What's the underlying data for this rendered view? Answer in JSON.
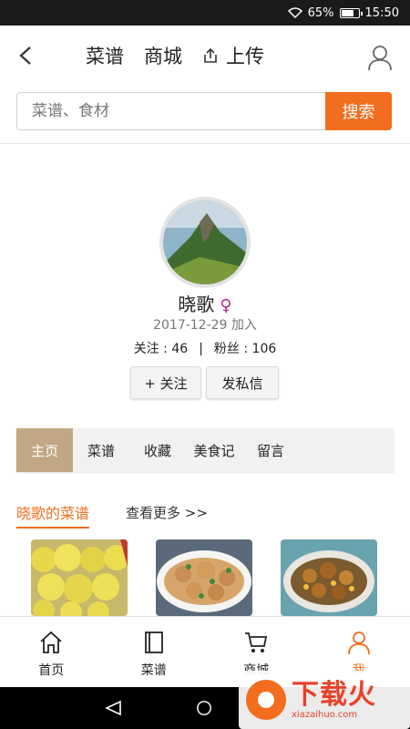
{
  "status_bar": {
    "battery": "65%",
    "time": "15:50",
    "battery_level": 0.65
  },
  "top_nav": {
    "recipes": "菜谱",
    "mall": "商城",
    "upload": "上传"
  },
  "search": {
    "placeholder": "菜谱、食材",
    "button": "搜索"
  },
  "profile": {
    "name": "晓歌",
    "gender_symbol": "♀",
    "joined": "2017-12-29 加入",
    "following_label": "关注",
    "following": "46",
    "followers_label": "粉丝",
    "followers": "106",
    "follow_button": "+ 关注",
    "message_button": "发私信"
  },
  "tabs": [
    "主页",
    "菜谱",
    "收藏",
    "美食记",
    "留言"
  ],
  "recipes_section": {
    "title": "晓歌的菜谱",
    "more": "查看更多 >>"
  },
  "bottom_nav": [
    "首页",
    "菜谱",
    "商城",
    "我"
  ],
  "watermark": {
    "brand": "下载火",
    "site": "xiazaihuo.com"
  },
  "colors": {
    "accent": "#f26d1e",
    "tab_active": "#c2a784",
    "gender": "#b2298a"
  }
}
